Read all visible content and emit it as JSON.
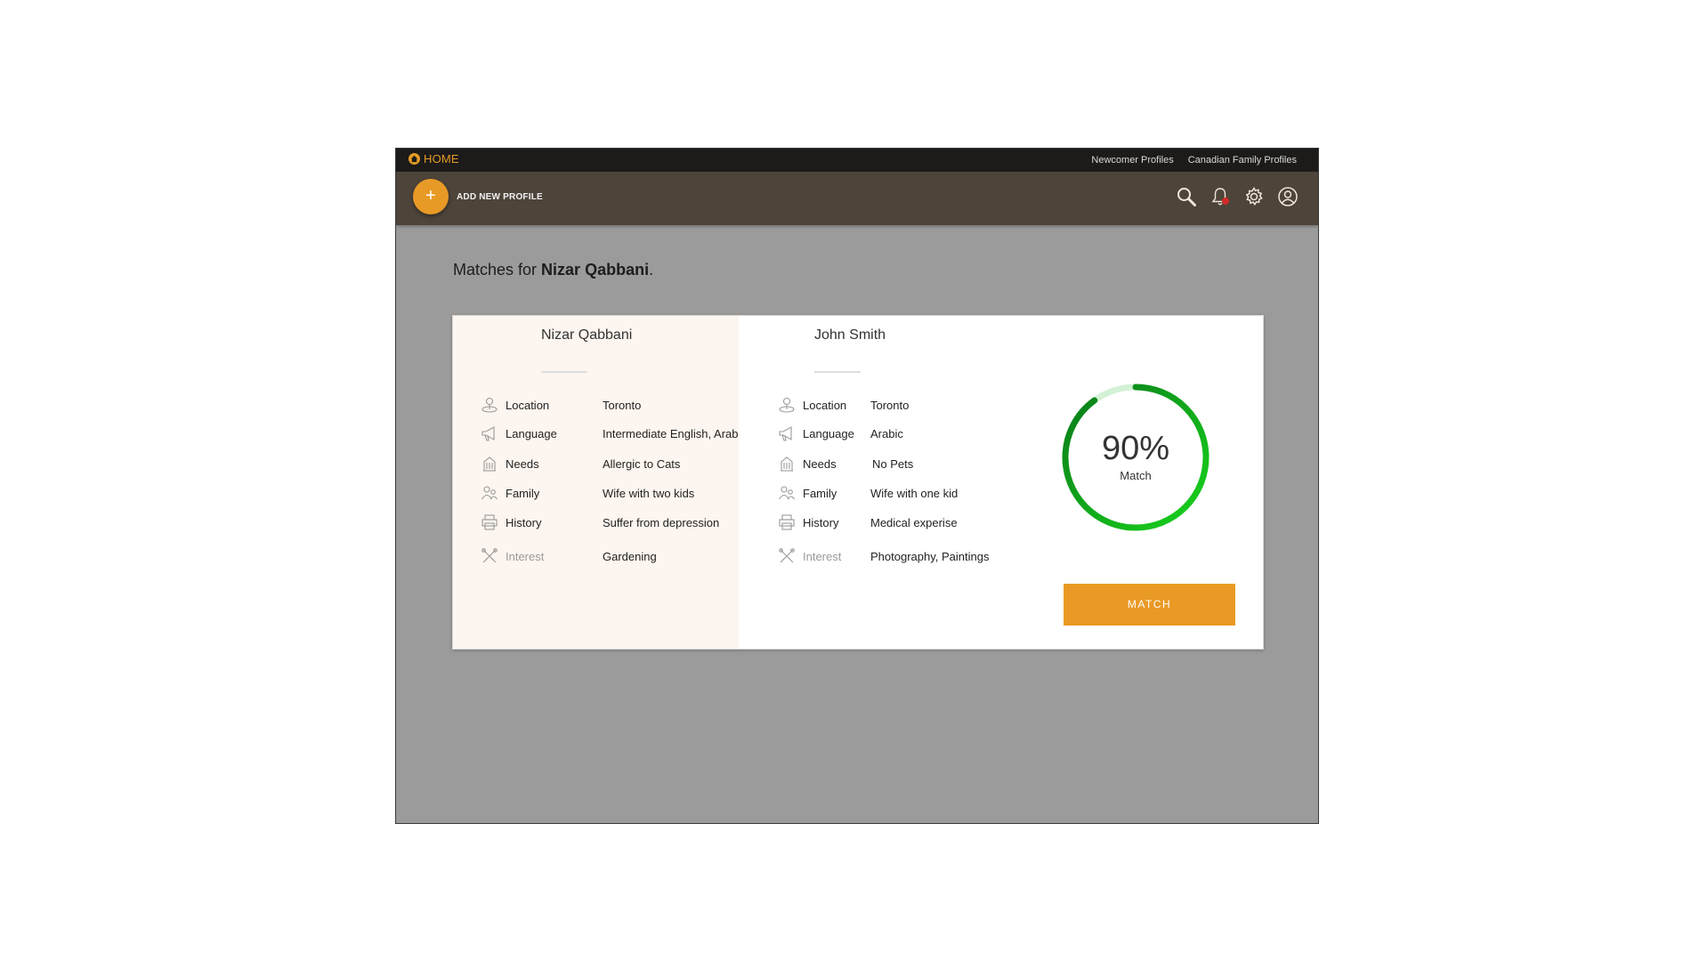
{
  "topbar": {
    "brand_label": "HOME",
    "links": [
      "Newcomer Profiles",
      "Canadian Family Profiles"
    ]
  },
  "toolbar": {
    "add_icon": "+",
    "add_label": "ADD NEW PROFILE",
    "icons": [
      "search-icon",
      "bell-icon",
      "gear-icon",
      "user-icon"
    ]
  },
  "main": {
    "title_prefix": "Matches for ",
    "title_name": "Nizar Qabbani",
    "title_suffix": "."
  },
  "labels": {
    "location": "Location",
    "language": "Language",
    "needs": "Needs",
    "family": "Family",
    "history": "History",
    "interest": "Interest"
  },
  "left_profile": {
    "name": "Nizar Qabbani",
    "location": "Toronto",
    "language": "Intermediate English, Arabic",
    "needs": "Allergic to Cats",
    "family": "Wife with  two kids",
    "history": "Suffer from depression",
    "interest": "Gardening"
  },
  "right_profile": {
    "name": "John Smith",
    "location": "Toronto",
    "language": "Arabic",
    "needs": "No Pets",
    "family": "Wife with one kid",
    "history": "Medical experise",
    "interest": "Photography, Paintings"
  },
  "match": {
    "percent": 90,
    "percent_text": "90%",
    "label": "Match",
    "button_label": "MATCH"
  },
  "colors": {
    "accent": "#e99a25",
    "ring_dark": "#0a7a1a",
    "ring_bright": "#19d41d",
    "ring_track": "#d3f1d5"
  }
}
